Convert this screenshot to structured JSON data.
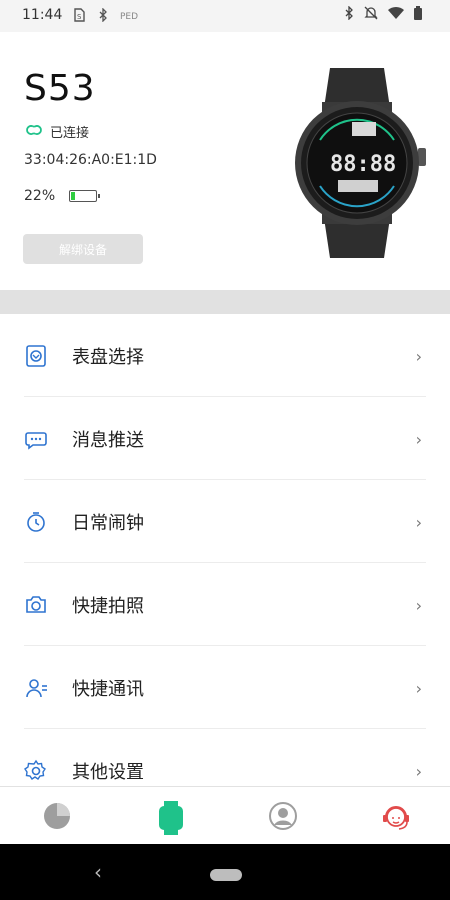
{
  "status_bar": {
    "time": "11:44",
    "left_icons": [
      "sim-icon",
      "bluetooth-icon"
    ],
    "small_text": "PED",
    "right_icons": [
      "bluetooth-icon",
      "mute-icon",
      "wifi-icon",
      "battery-icon"
    ]
  },
  "device": {
    "name": "S53",
    "connection_status": "已连接",
    "mac_address": "33:04:26:A0:E1:1D",
    "battery_percent_text": "22%",
    "battery_level": 0.22,
    "unbind_label": "解绑设备"
  },
  "menu": {
    "items": [
      {
        "label": "表盘选择",
        "icon": "watch-face-icon"
      },
      {
        "label": "消息推送",
        "icon": "message-icon"
      },
      {
        "label": "日常闹钟",
        "icon": "alarm-icon"
      },
      {
        "label": "快捷拍照",
        "icon": "camera-icon"
      },
      {
        "label": "快捷通讯",
        "icon": "contacts-icon"
      },
      {
        "label": "其他设置",
        "icon": "settings-icon"
      }
    ]
  },
  "tabs": [
    {
      "name": "stats-tab",
      "icon": "pie-chart-icon"
    },
    {
      "name": "device-tab",
      "icon": "watch-icon",
      "active": true
    },
    {
      "name": "profile-tab",
      "icon": "user-icon"
    },
    {
      "name": "support-tab",
      "icon": "customer-service-icon"
    }
  ],
  "colors": {
    "accent_green": "#1fc28a",
    "menu_icon_blue": "#2f74d0",
    "support_red": "#e14b4b",
    "inactive_gray": "#9e9e9e"
  }
}
